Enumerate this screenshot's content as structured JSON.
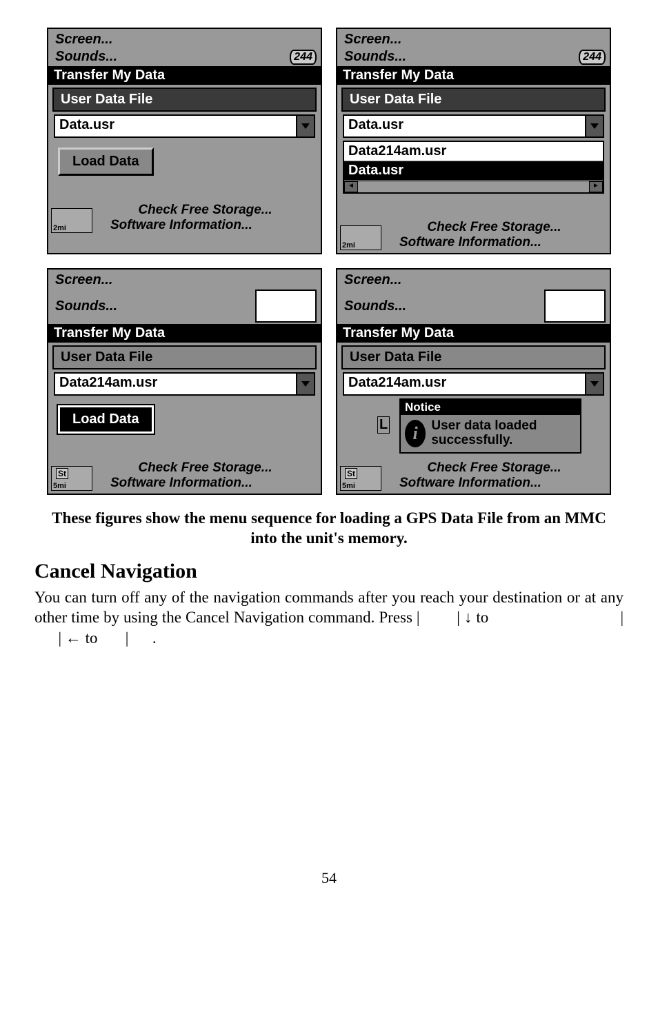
{
  "screens": {
    "common": {
      "screen_menu": "Screen...",
      "sounds_menu": "Sounds...",
      "transfer_header": "Transfer My Data",
      "user_data_file": "User Data File",
      "check_free": "Check Free Storage...",
      "software_info": "Software Information...",
      "badge_244": "244"
    },
    "s1": {
      "dropdown_value": "Data.usr",
      "load_button": "Load Data",
      "map_scale": "2mi"
    },
    "s2": {
      "dropdown_value": "Data.usr",
      "dd_option1": "Data214am.usr",
      "dd_option2": "Data.usr",
      "map_scale": "2mi"
    },
    "s3": {
      "dropdown_value": "Data214am.usr",
      "load_button": "Load Data",
      "map_label": "St",
      "map_scale": "5mi"
    },
    "s4": {
      "dropdown_value": "Data214am.usr",
      "notice_title": "Notice",
      "notice_text": "User data loaded successfully.",
      "map_label": "St",
      "map_scale": "5mi",
      "L": "L"
    }
  },
  "caption": "These figures show the menu sequence for loading a GPS Data File from an MMC into the unit's memory.",
  "section_heading": "Cancel Navigation",
  "body": {
    "p1a": "You can turn off any of the navigation commands after you reach your destination or at any other time by using the Cancel Navigation command. Press ",
    "sep1": "|",
    "sep2": "|",
    "arrow_down": "↓",
    "to1": " to ",
    "sep3": "|",
    "sep4": "|",
    "arrow_left": "←",
    "to2": " to ",
    "sep5": "|",
    "dot": "."
  },
  "page_number": "54"
}
